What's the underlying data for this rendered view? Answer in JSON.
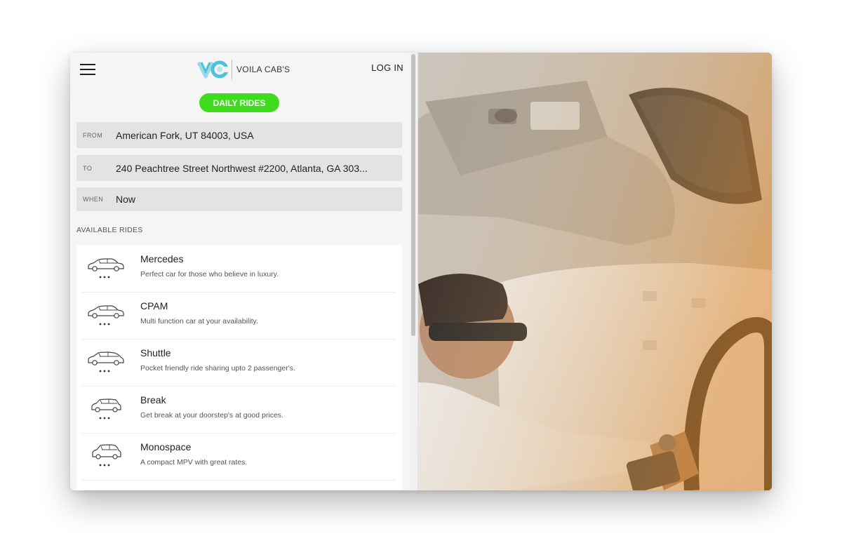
{
  "header": {
    "brand": "VOILA CAB'S",
    "login_label": "LOG IN"
  },
  "daily_button": "DAILY RIDES",
  "trip": {
    "from_label": "FROM",
    "from_value": "American Fork, UT 84003, USA",
    "to_label": "TO",
    "to_value": "240 Peachtree Street Northwest #2200, Atlanta, GA 303...",
    "when_label": "WHEN",
    "when_value": "Now"
  },
  "available_title": "AVAILABLE RIDES",
  "rides": [
    {
      "name": "Mercedes",
      "desc": "Perfect car for those who believe in luxury.",
      "icon": "sedan-icon"
    },
    {
      "name": "CPAM",
      "desc": "Multi function car at your availability.",
      "icon": "sedan-icon"
    },
    {
      "name": "Shuttle",
      "desc": "Pocket friendly ride sharing upto 2 passenger's.",
      "icon": "hatchback-icon"
    },
    {
      "name": "Break",
      "desc": "Get break at your doorstep's at good prices.",
      "icon": "wagon-icon"
    },
    {
      "name": "Monospace",
      "desc": "A compact MPV with great rates.",
      "icon": "mpv-icon"
    }
  ],
  "colors": {
    "accent_green": "#3ddc1c",
    "logo_teal": "#4cc3d9",
    "field_bg": "#e3e3e3"
  }
}
